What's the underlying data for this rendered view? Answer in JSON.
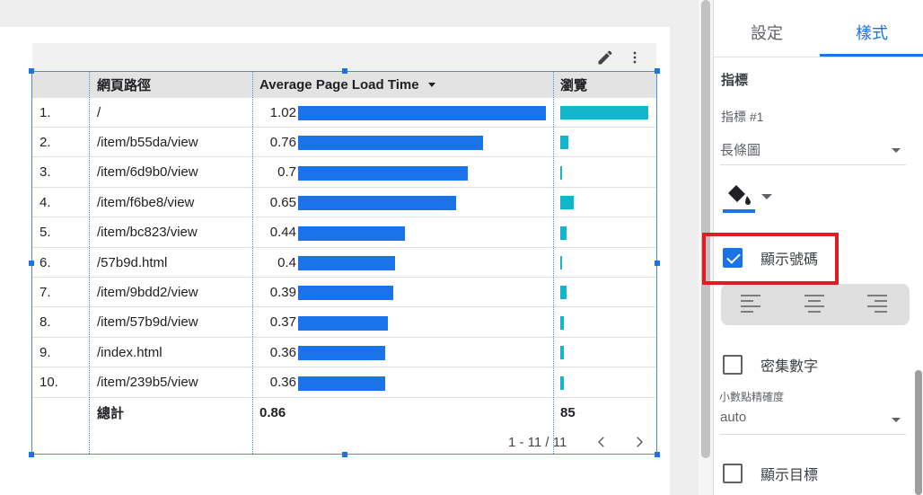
{
  "chart": {
    "columns": {
      "dimension": "網頁路徑",
      "metric": "Average Page Load Time",
      "views": "瀏覽"
    },
    "rows": [
      {
        "idx": "1.",
        "path": "/",
        "load": "1.02",
        "load_value": 1.02,
        "views_share": 1.0
      },
      {
        "idx": "2.",
        "path": "/item/b55da/view",
        "load": "0.76",
        "load_value": 0.76,
        "views_share": 0.09
      },
      {
        "idx": "3.",
        "path": "/item/6d9b0/view",
        "load": "0.7",
        "load_value": 0.7,
        "views_share": 0.02
      },
      {
        "idx": "4.",
        "path": "/item/f6be8/view",
        "load": "0.65",
        "load_value": 0.65,
        "views_share": 0.15
      },
      {
        "idx": "5.",
        "path": "/item/bc823/view",
        "load": "0.44",
        "load_value": 0.44,
        "views_share": 0.07
      },
      {
        "idx": "6.",
        "path": "/57b9d.html",
        "load": "0.4",
        "load_value": 0.4,
        "views_share": 0.02
      },
      {
        "idx": "7.",
        "path": "/item/9bdd2/view",
        "load": "0.39",
        "load_value": 0.39,
        "views_share": 0.07
      },
      {
        "idx": "8.",
        "path": "/item/57b9d/view",
        "load": "0.37",
        "load_value": 0.37,
        "views_share": 0.04
      },
      {
        "idx": "9.",
        "path": "/index.html",
        "load": "0.36",
        "load_value": 0.36,
        "views_share": 0.04
      },
      {
        "idx": "10.",
        "path": "/item/239b5/view",
        "load": "0.36",
        "load_value": 0.36,
        "views_share": 0.04
      }
    ],
    "total": {
      "label": "總計",
      "load": "0.86",
      "views": "85"
    },
    "pagination": "1 - 11 / 11",
    "colors": {
      "metric_bar": "#1a73e8",
      "views_bar": "#12b5cb"
    }
  },
  "panel": {
    "tabs": {
      "setup": "設定",
      "style": "樣式"
    },
    "section_title": "指標",
    "metric_label": "指標 #1",
    "chart_type_value": "長條圖",
    "fill_color": "#1a73e8",
    "show_number_label": "顯示號碼",
    "show_number_checked": true,
    "compact_numbers_label": "密集數字",
    "compact_numbers_checked": false,
    "decimal_precision_label": "小數點精確度",
    "decimal_precision_value": "auto",
    "show_target_label": "顯示目標",
    "show_target_checked": false
  },
  "icons": {
    "edit": "pencil-icon",
    "more": "more-vert-icon",
    "fill": "paint-bucket-icon",
    "prev": "chevron-left-icon",
    "next": "chevron-right-icon"
  },
  "highlight_color": "#e21b23"
}
